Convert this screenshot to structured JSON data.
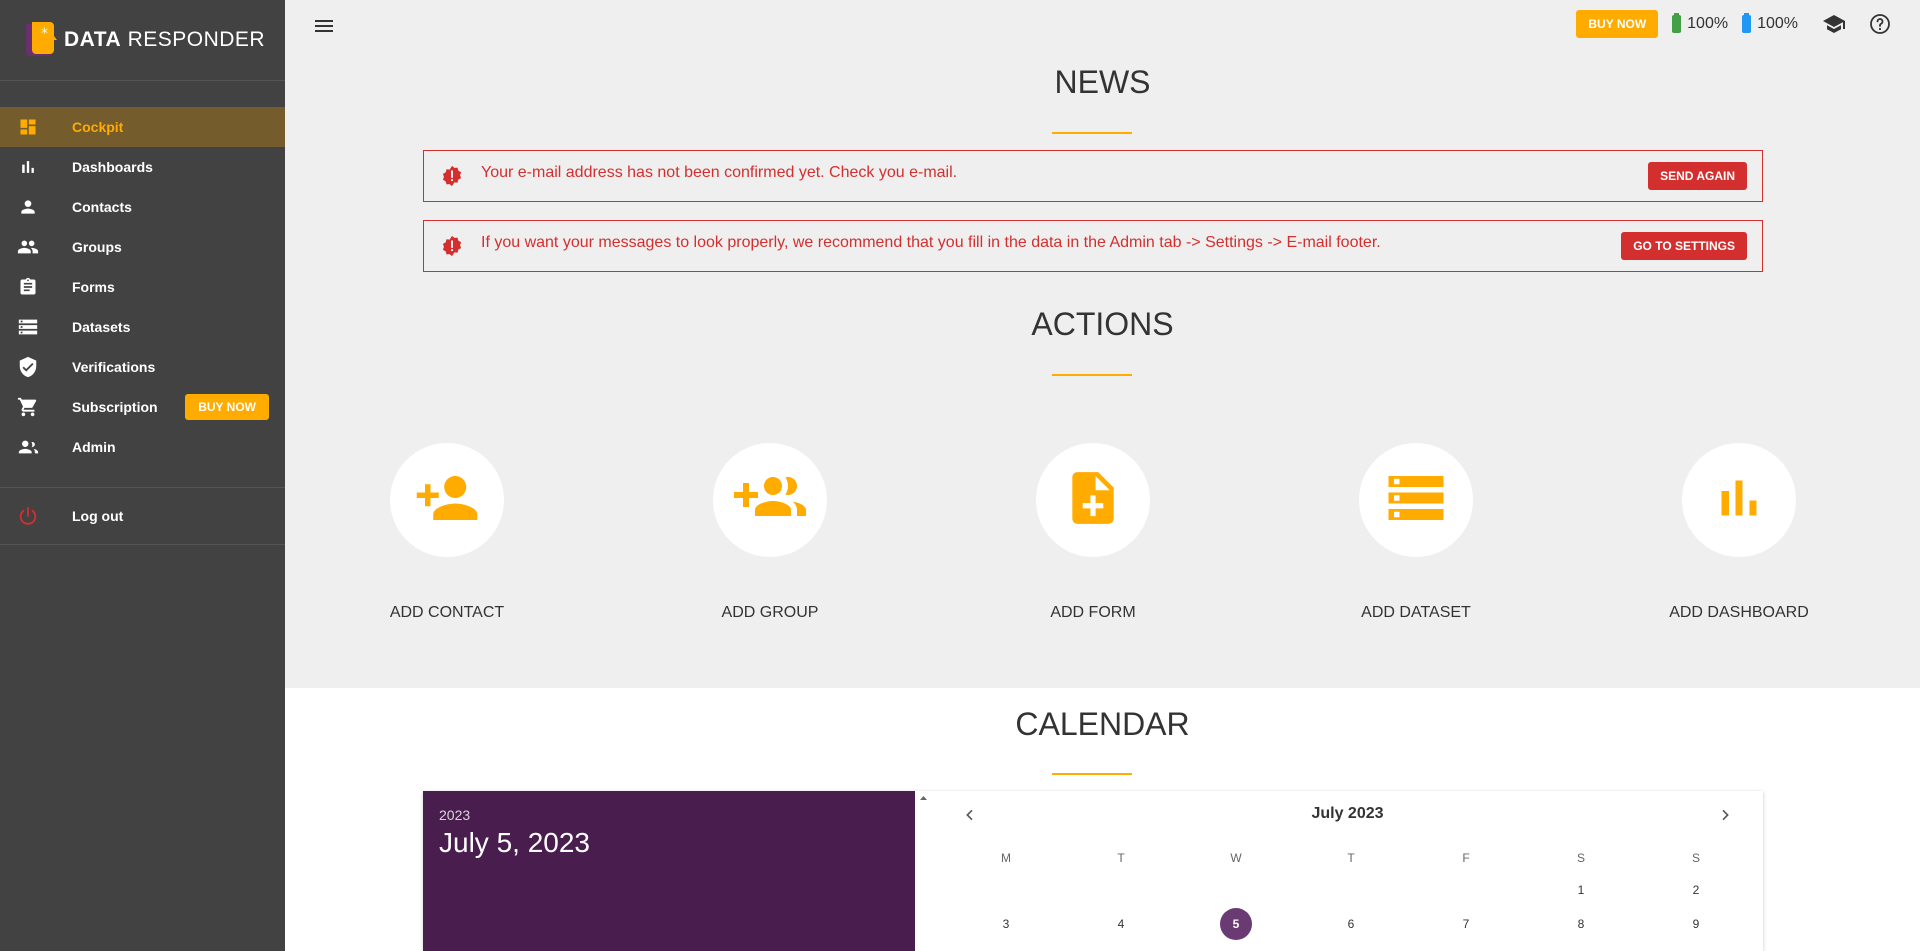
{
  "app": {
    "logo_bold": "DATA",
    "logo_light": "RESPONDER"
  },
  "sidebar": {
    "items": [
      {
        "label": "Cockpit",
        "icon": "dashboard-icon",
        "active": true
      },
      {
        "label": "Dashboards",
        "icon": "bar-chart-icon"
      },
      {
        "label": "Contacts",
        "icon": "person-icon"
      },
      {
        "label": "Groups",
        "icon": "people-icon"
      },
      {
        "label": "Forms",
        "icon": "clipboard-icon"
      },
      {
        "label": "Datasets",
        "icon": "list-icon"
      },
      {
        "label": "Verifications",
        "icon": "shield-check-icon"
      },
      {
        "label": "Subscription",
        "icon": "cart-icon",
        "badge": "BUY NOW"
      },
      {
        "label": "Admin",
        "icon": "admin-people-icon"
      }
    ],
    "logout": "Log out"
  },
  "topbar": {
    "buy_now": "BUY NOW",
    "battery_green": "100%",
    "battery_blue": "100%"
  },
  "news": {
    "title": "NEWS",
    "alerts": [
      {
        "text": "Your e-mail address has not been confirmed yet. Check you e-mail.",
        "button": "SEND AGAIN"
      },
      {
        "text": "If you want your messages to look properly, we recommend that you fill in the data in the Admin tab -> Settings -> E-mail footer.",
        "button": "GO TO SETTINGS"
      }
    ]
  },
  "actions": {
    "title": "ACTIONS",
    "items": [
      {
        "label": "ADD CONTACT",
        "icon": "add-person-icon"
      },
      {
        "label": "ADD GROUP",
        "icon": "add-group-icon"
      },
      {
        "label": "ADD FORM",
        "icon": "add-form-icon"
      },
      {
        "label": "ADD DATASET",
        "icon": "dataset-icon"
      },
      {
        "label": "ADD DASHBOARD",
        "icon": "bar-chart-icon"
      }
    ]
  },
  "calendar": {
    "title": "CALENDAR",
    "year": "2023",
    "selected_date": "July 5, 2023",
    "month": "July 2023",
    "weekdays": [
      "M",
      "T",
      "W",
      "T",
      "F",
      "S",
      "S"
    ],
    "row1": [
      "1",
      "2"
    ],
    "row2": [
      "3",
      "4",
      "5",
      "6",
      "7",
      "8",
      "9"
    ],
    "selected_day": "5"
  },
  "colors": {
    "accent": "#ffab00",
    "sidebar": "#424242",
    "error": "#d32f2f",
    "calendar_header": "#4a1d4f"
  }
}
